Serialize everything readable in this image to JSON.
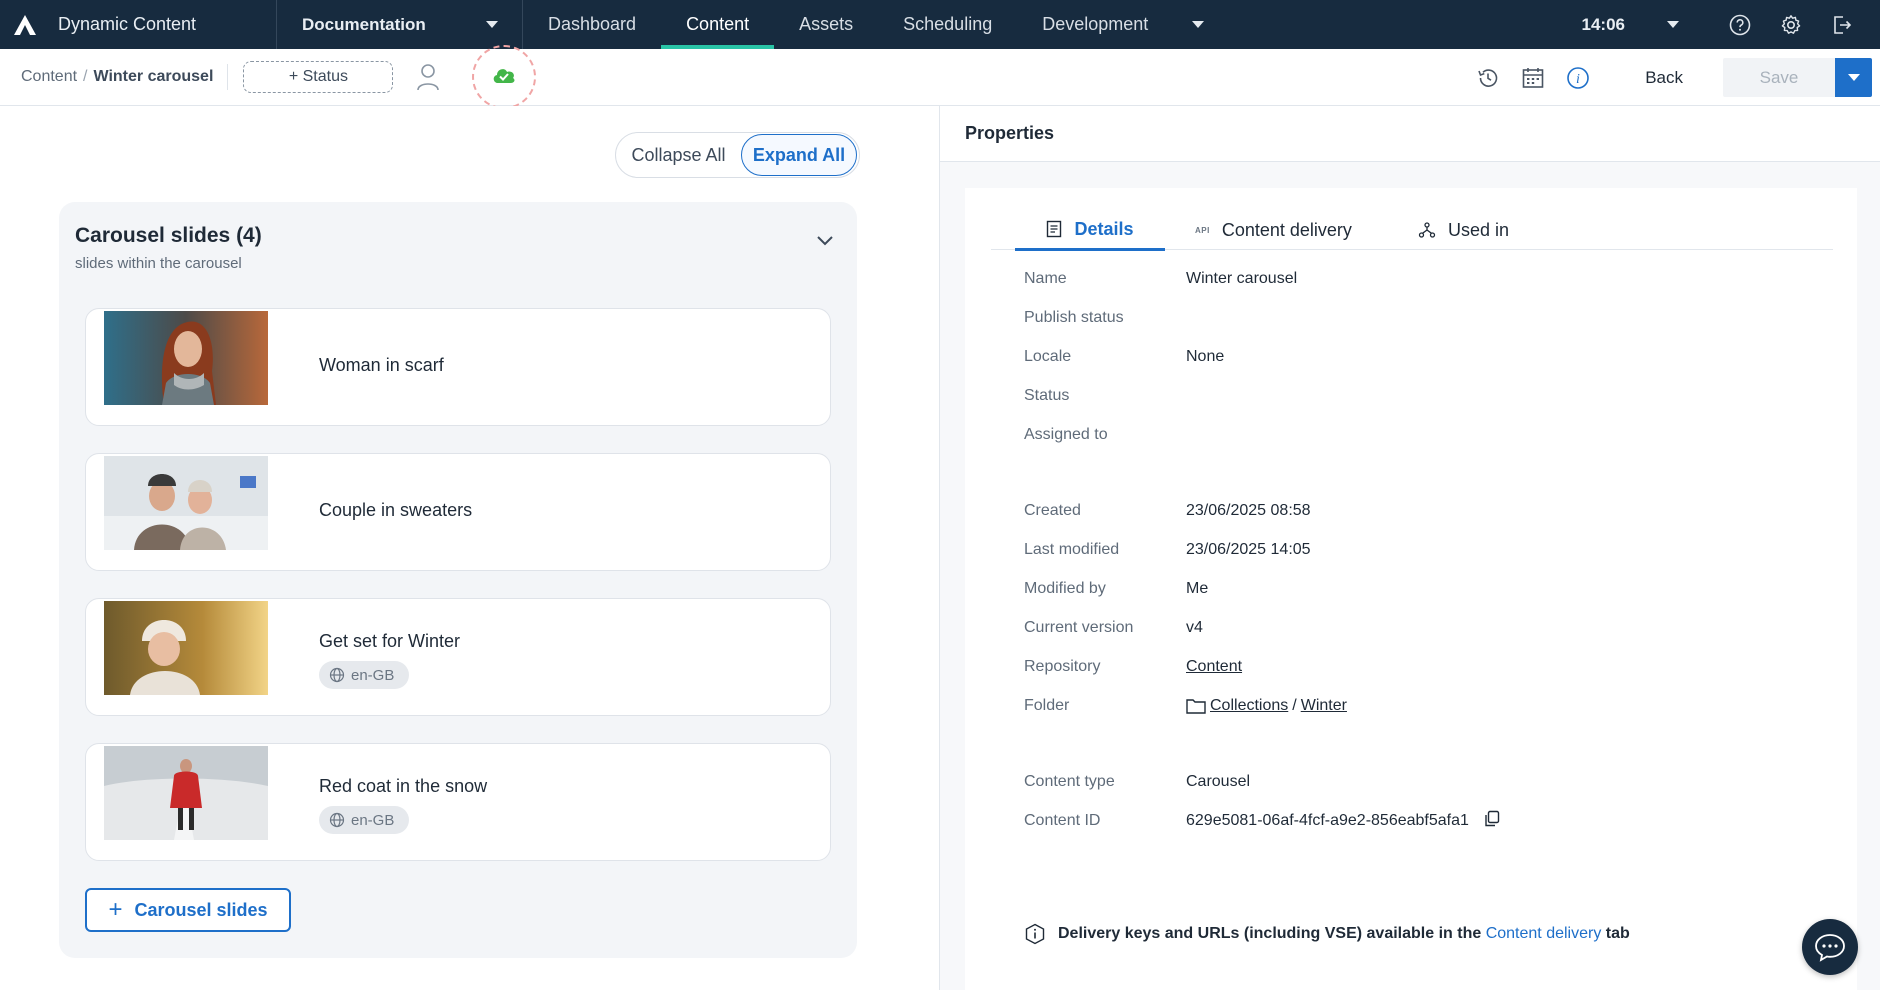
{
  "app": {
    "title": "Dynamic Content",
    "hub": "Documentation",
    "clock": "14:06"
  },
  "nav": {
    "tabs": [
      {
        "label": "Dashboard"
      },
      {
        "label": "Content"
      },
      {
        "label": "Assets"
      },
      {
        "label": "Scheduling"
      },
      {
        "label": "Development"
      }
    ]
  },
  "toolbar": {
    "breadcrumb_root": "Content",
    "breadcrumb_sep": "/",
    "breadcrumb_current": "Winter carousel",
    "status_label": "+ Status",
    "back_label": "Back",
    "save_label": "Save"
  },
  "left": {
    "collapse_label": "Collapse All",
    "expand_label": "Expand All",
    "section_title": "Carousel slides (4)",
    "section_subtitle": "slides within the carousel",
    "slides": [
      {
        "title": "Woman in scarf",
        "locale": ""
      },
      {
        "title": "Couple in sweaters",
        "locale": ""
      },
      {
        "title": "Get set for Winter",
        "locale": "en-GB"
      },
      {
        "title": "Red coat in the snow",
        "locale": "en-GB"
      }
    ],
    "add_label": "Carousel slides"
  },
  "properties": {
    "heading": "Properties",
    "tabs": {
      "details": "Details",
      "api_tag": "API",
      "delivery": "Content delivery",
      "used_in": "Used in"
    },
    "fields": {
      "name": {
        "label": "Name",
        "value": "Winter carousel"
      },
      "publish_status": {
        "label": "Publish status",
        "value": ""
      },
      "locale": {
        "label": "Locale",
        "value": "None"
      },
      "status": {
        "label": "Status",
        "value": ""
      },
      "assigned_to": {
        "label": "Assigned to",
        "value": ""
      },
      "created": {
        "label": "Created",
        "value": "23/06/2025 08:58"
      },
      "last_modified": {
        "label": "Last modified",
        "value": "23/06/2025 14:05"
      },
      "modified_by": {
        "label": "Modified by",
        "value": "Me"
      },
      "current_version": {
        "label": "Current version",
        "value": "v4"
      },
      "repository": {
        "label": "Repository",
        "value": "Content"
      },
      "folder": {
        "label": "Folder",
        "parent": "Collections",
        "sep": "/",
        "child": "Winter"
      },
      "content_type": {
        "label": "Content type",
        "value": "Carousel"
      },
      "content_id": {
        "label": "Content ID",
        "value": "629e5081-06af-4fcf-a9e2-856eabf5afa1"
      }
    },
    "note": {
      "text": "Delivery keys and URLs (including VSE) available in the",
      "link": "Content delivery",
      "suffix": "tab"
    }
  },
  "colors": {
    "nav_bg": "#172b3f",
    "accent_blue": "#1e6fc9",
    "active_tab_underline": "#29c4a6",
    "sync_green": "#43b649"
  }
}
